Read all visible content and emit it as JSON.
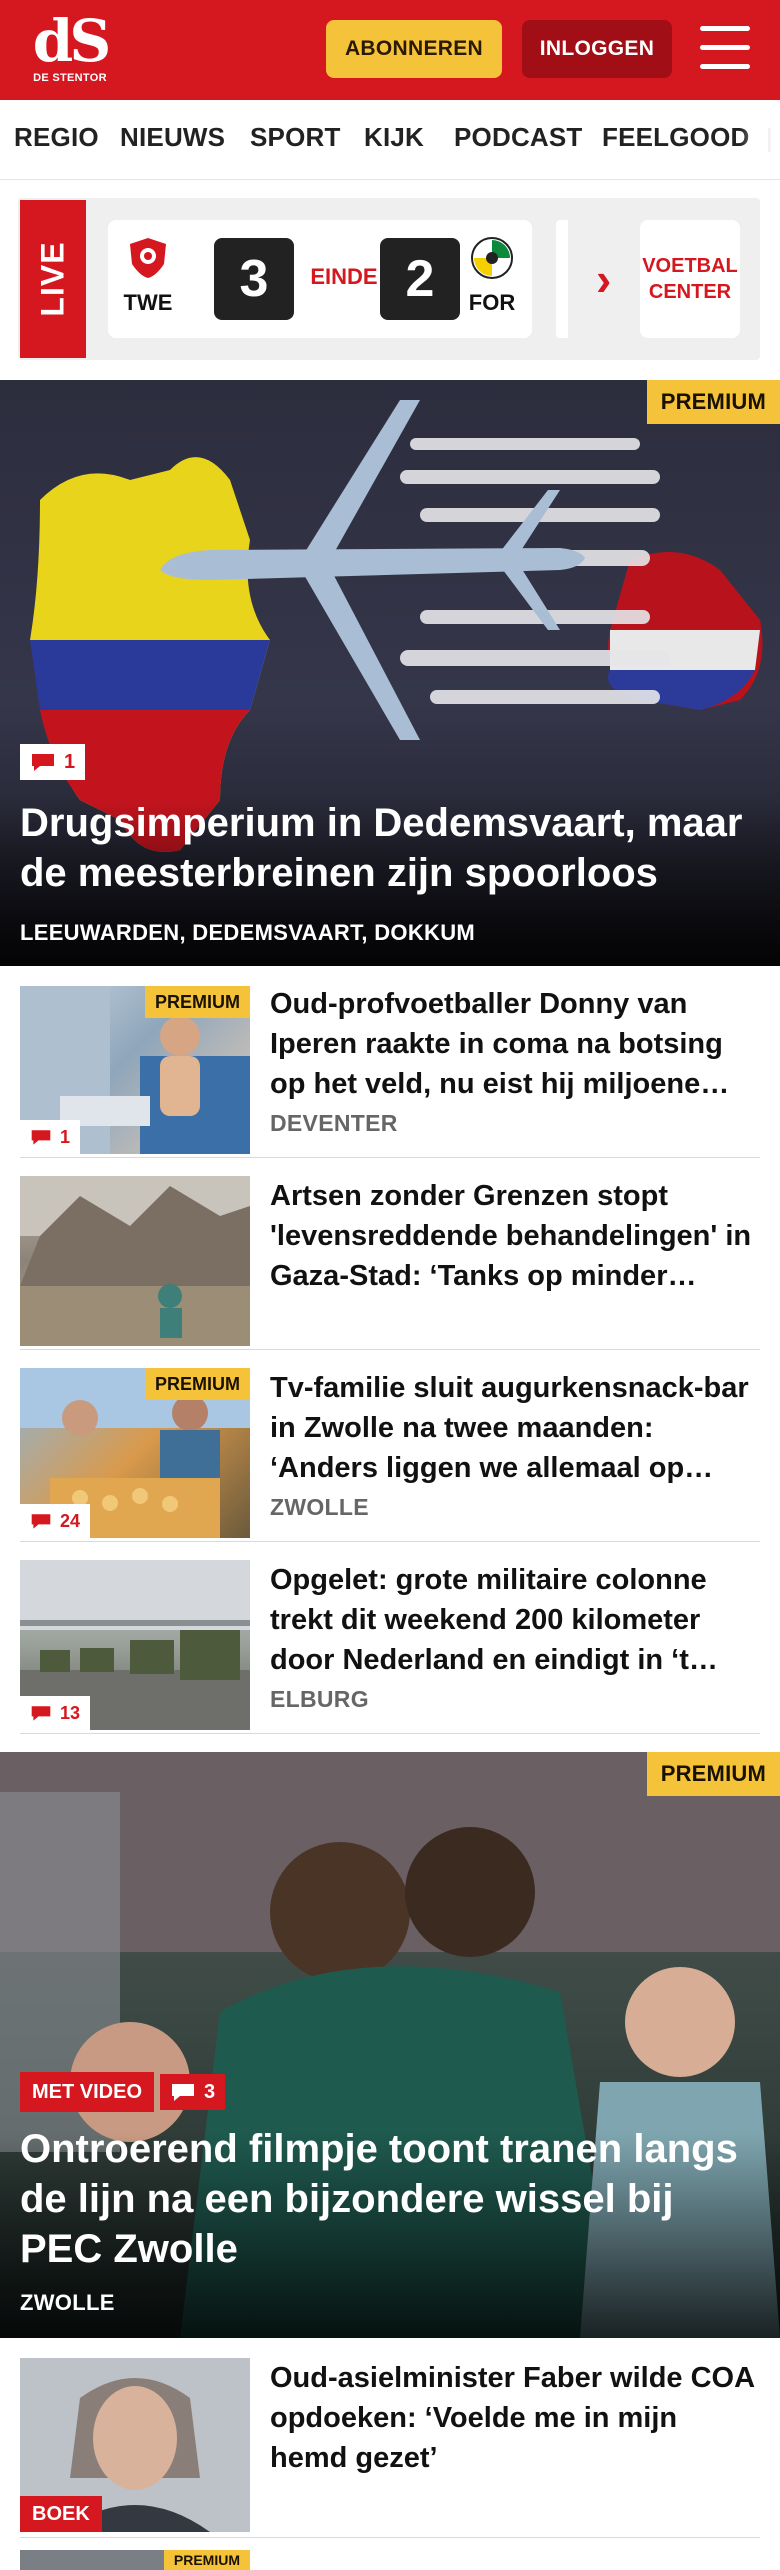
{
  "header": {
    "logo_mark": "dS",
    "logo_sub": "DE STENTOR",
    "subscribe_label": "ABONNEREN",
    "login_label": "INLOGGEN",
    "brand_color": "#d5171f",
    "accent_color": "#f5c33a"
  },
  "nav": {
    "items": [
      "REGIO",
      "NIEUWS",
      "SPORT",
      "KIJK",
      "PODCAST",
      "FEELGOOD"
    ]
  },
  "live_widget": {
    "tag": "LIVE",
    "home_code": "TWE",
    "home_score": "3",
    "status": "EINDE",
    "away_score": "2",
    "away_code": "FOR",
    "center_label_1": "VOETBAL",
    "center_label_2": "CENTER"
  },
  "hero1": {
    "premium": "PREMIUM",
    "comments": "1",
    "title": "Drugsimperium in Dedemsvaart, maar de meesterbreinen zijn spoorloos",
    "location": "LEEUWARDEN, DEDEMSVAART, DOKKUM"
  },
  "articles": [
    {
      "premium": "PREMIUM",
      "comments": "1",
      "title": "Oud-profvoetballer Donny van Iperen raakte in coma na botsing op het veld, nu eist hij miljoene…",
      "location": "DEVENTER"
    },
    {
      "title": "Artsen zonder Grenzen stopt 'levensreddende behandelingen' in Gaza-Stad: ‘Tanks op minder…",
      "location": ""
    },
    {
      "premium": "PREMIUM",
      "comments": "24",
      "title": "Tv-familie sluit augurkensnack-bar in Zwolle na twee maanden: ‘Anders liggen we allemaal op…",
      "location": "ZWOLLE"
    },
    {
      "comments": "13",
      "title": "Opgelet: grote militaire colonne trekt dit weekend 200 kilometer door Nederland en eindigt in ‘t…",
      "location": "ELBURG"
    }
  ],
  "hero2": {
    "premium": "PREMIUM",
    "video_label": "MET VIDEO",
    "comments": "3",
    "title": "Ontroerend filmpje toont tranen langs de lijn na een bijzondere wissel bij PEC Zwolle",
    "location": "ZWOLLE"
  },
  "article5": {
    "tag": "BOEK",
    "title": "Oud-asielminister Faber wilde COA opdoeken: ‘Voelde me in mijn hemd gezet’"
  },
  "article6": {
    "premium": "PREMIUM"
  }
}
